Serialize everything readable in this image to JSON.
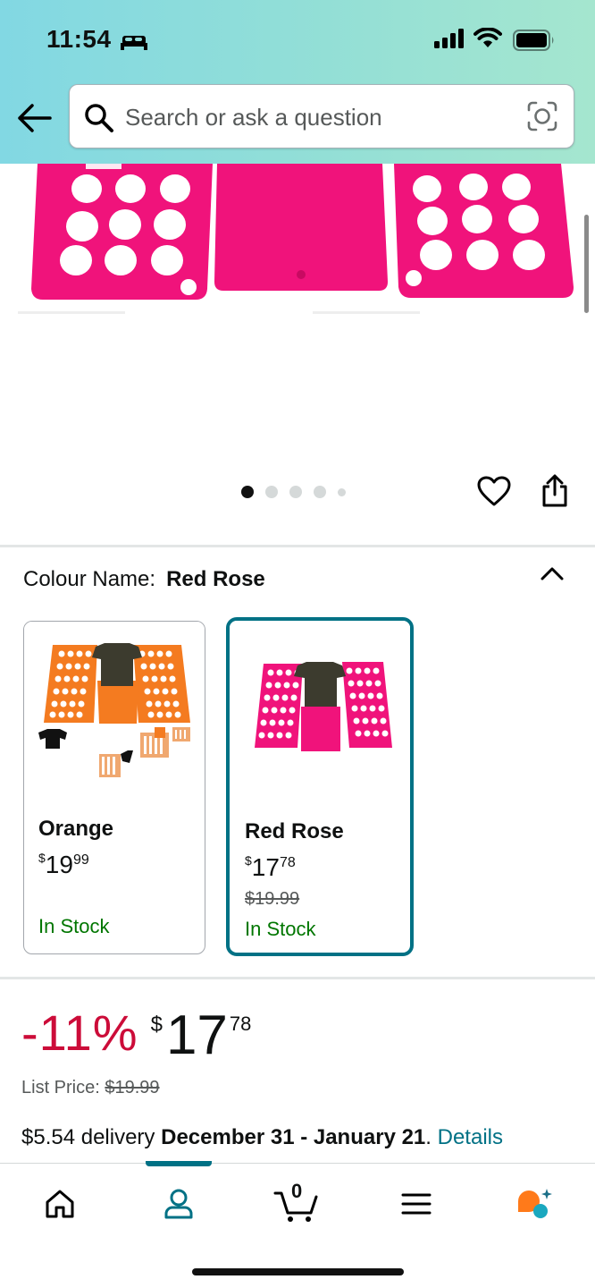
{
  "status_bar": {
    "time": "11:54"
  },
  "search": {
    "placeholder": "Search or ask a question"
  },
  "carousel": {
    "dot_count": 5,
    "active_index": 0
  },
  "colour": {
    "label": "Colour Name:",
    "selected": "Red Rose"
  },
  "variants": [
    {
      "name": "Orange",
      "price_symbol": "$",
      "price_whole": "19",
      "price_fraction": "99",
      "list_price": "",
      "stock": "In Stock",
      "selected": false,
      "color": "#f47b20"
    },
    {
      "name": "Red Rose",
      "price_symbol": "$",
      "price_whole": "17",
      "price_fraction": "78",
      "list_price": "$19.99",
      "stock": "In Stock",
      "selected": true,
      "color": "#f0137b"
    }
  ],
  "pricing": {
    "discount": "-11%",
    "symbol": "$",
    "whole": "17",
    "fraction": "78",
    "list_price_label": "List Price:",
    "list_price": "$19.99"
  },
  "delivery": {
    "cost": "$5.54 delivery",
    "dates": "December 31 - January 21",
    "link": "Details"
  },
  "nav": {
    "items": [
      "home-icon",
      "account-icon",
      "cart-icon",
      "menu-icon",
      "rufus-icon"
    ],
    "cart_count": "0",
    "active_index": 1
  },
  "colors": {
    "accent": "#007185",
    "discount": "#cc0c39",
    "stock": "#007600",
    "product_pink": "#f0137b",
    "product_orange": "#f47b20"
  }
}
